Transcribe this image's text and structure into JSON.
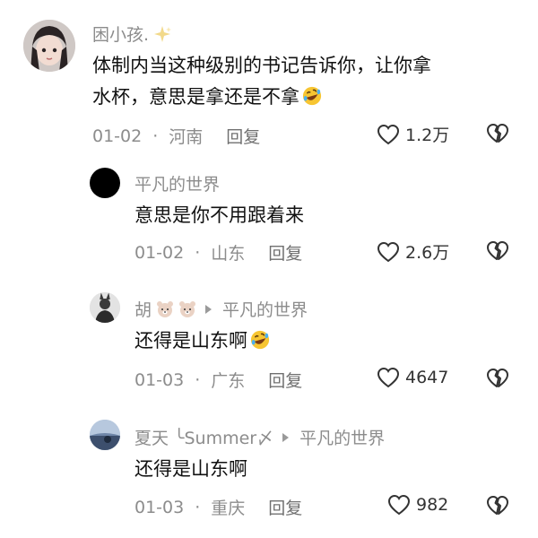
{
  "comments": [
    {
      "author": "困小孩.",
      "text_line1": "体制内当这种级别的书记告诉你，让你拿",
      "text_line2": "水杯，意思是拿还是不拿",
      "date": "01-02",
      "location": "河南",
      "reply_label": "回复",
      "likes": "1.2万"
    },
    {
      "author": "平凡的世界",
      "text": "意思是你不用跟着来",
      "date": "01-02",
      "location": "山东",
      "reply_label": "回复",
      "likes": "2.6万"
    },
    {
      "author": "胡",
      "reply_to": "平凡的世界",
      "text": "还得是山东啊",
      "date": "01-03",
      "location": "广东",
      "reply_label": "回复",
      "likes": "4647"
    },
    {
      "author": "夏天 ╰Summer〆",
      "reply_to": "平凡的世界",
      "text": "还得是山东啊",
      "date": "01-03",
      "location": "重庆",
      "reply_label": "回复",
      "likes": "982"
    }
  ],
  "separator": "·",
  "icons": {
    "like": "heart-outline-icon",
    "dislike": "broken-heart-icon",
    "emoji": "rolling-laughing-emoji",
    "reply_arrow": "triangle-right-icon"
  },
  "colors": {
    "secondary_text": "#8c8c8c",
    "primary_text": "#111111"
  }
}
